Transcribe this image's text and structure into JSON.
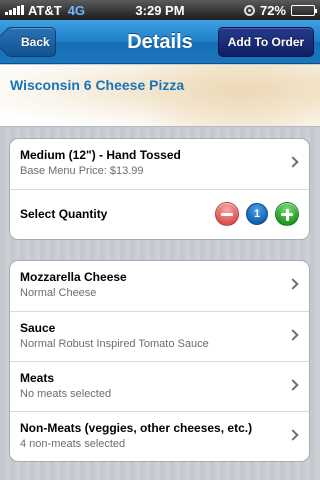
{
  "status_bar": {
    "carrier": "AT&T",
    "network": "4G",
    "time": "3:29 PM",
    "battery_percent": "72%",
    "battery_level": 0.72
  },
  "nav": {
    "back_label": "Back",
    "title": "Details",
    "action_label": "Add To Order"
  },
  "product": {
    "name": "Wisconsin 6 Cheese Pizza"
  },
  "options": {
    "size": {
      "title": "Medium (12\") - Hand Tossed",
      "subtitle": "Base Menu Price: $13.99"
    },
    "quantity": {
      "label": "Select Quantity",
      "value": "1"
    }
  },
  "toppings": [
    {
      "title": "Mozzarella Cheese",
      "subtitle": "Normal Cheese"
    },
    {
      "title": "Sauce",
      "subtitle": "Normal Robust Inspired Tomato Sauce"
    },
    {
      "title": "Meats",
      "subtitle": "No meats selected"
    },
    {
      "title": "Non-Meats (veggies, other cheeses, etc.)",
      "subtitle": "4 non-meats selected"
    }
  ],
  "colors": {
    "nav_blue": "#1f7fc9",
    "action_navy": "#1a2d78",
    "link_blue": "#1a74b8",
    "minus_red": "#e0524f",
    "plus_green": "#1f9a22"
  }
}
